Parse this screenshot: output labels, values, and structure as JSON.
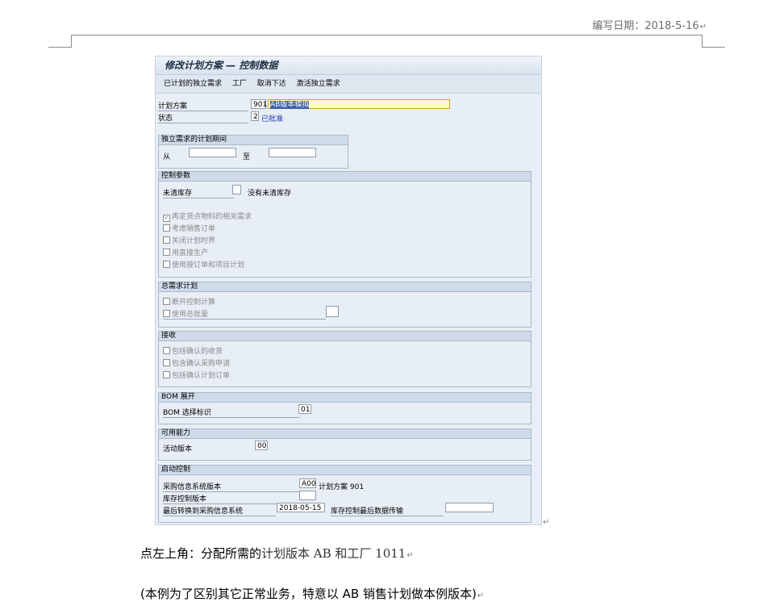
{
  "header": {
    "date_text": "编写日期：2018-5-16"
  },
  "sap": {
    "title": "修改计划方案 — 控制数据",
    "toolbar": [
      "已计划的独立需求",
      "工厂",
      "取消下达",
      "激活独立需求"
    ],
    "plan_scheme": {
      "label": "计划方案",
      "number": "901",
      "name": "AB版本模拟"
    },
    "status": {
      "label": "状态",
      "value": "2",
      "text": "已批准"
    },
    "period": {
      "title": "独立需求的计划期间",
      "from_label": "从",
      "to_label": "至",
      "from_value": "",
      "to_value": ""
    },
    "control": {
      "title": "控制参数",
      "stock_label": "未清库存",
      "stock_value": "",
      "stock_text": "没有未清库存",
      "checkboxes": [
        {
          "label": "再定货点物料的相关需求",
          "checked": true
        },
        {
          "label": "考虑销售订单",
          "checked": false
        },
        {
          "label": "关闭计划时界",
          "checked": false
        },
        {
          "label": "用直接生产",
          "checked": false
        },
        {
          "label": "使用按订单和项目计划",
          "checked": false
        }
      ]
    },
    "total": {
      "title": "总需求计划",
      "checkboxes": [
        {
          "label": "断开控制计算",
          "checked": false
        },
        {
          "label": "使用总批量",
          "checked": false
        }
      ],
      "field_value": ""
    },
    "receipt": {
      "title": "接收",
      "checkboxes": [
        {
          "label": "包括确认的收货",
          "checked": false
        },
        {
          "label": "包含确认采购申请",
          "checked": false
        },
        {
          "label": "包括确认计划订单",
          "checked": false
        }
      ]
    },
    "bom": {
      "title": "BOM 展开",
      "label": "BOM 选择标识",
      "value": "01"
    },
    "capacity": {
      "title": "可用能力",
      "label": "活动版本",
      "value": "00"
    },
    "trigger": {
      "title": "启动控制",
      "row1_label": "采购信息系统版本",
      "row1_value": "A00",
      "row1_text": "计划方案 901",
      "row2_label": "库存控制版本",
      "row2_value": "",
      "row3_label": "最后转换到采购信息系统",
      "row3_value": "2018-05-15",
      "row3_text": "库存控制最后数据传输",
      "row3_value2": ""
    }
  },
  "body": {
    "line1_a": "点左上角：分配所需的",
    "line1_b": "计划版本 AB 和工厂 1011",
    "line2": "(本例为了区别其它正常业务，特意以 AB 销售计划做本例版本)"
  },
  "marks": {
    "return_mark": "↵"
  }
}
